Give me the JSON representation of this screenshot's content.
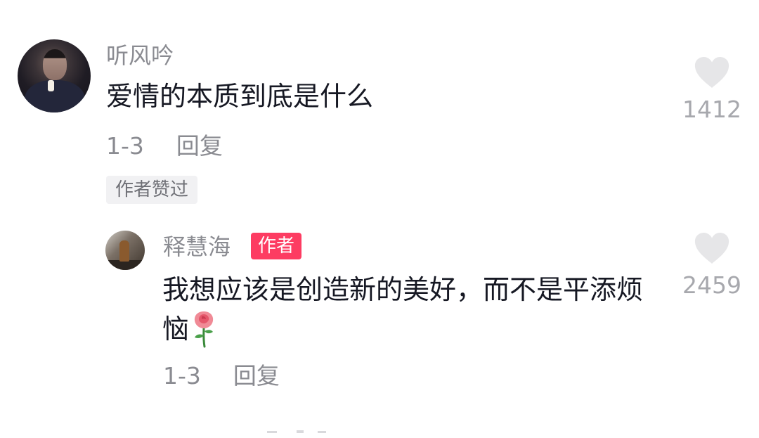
{
  "comment": {
    "username": "听风吟",
    "text": "爱情的本质到底是什么",
    "date": "1-3",
    "reply_label": "回复",
    "liked_by_author_tag": "作者赞过",
    "like_count": "1412",
    "like_icon": "heart-icon"
  },
  "reply": {
    "username": "释慧海",
    "author_badge": "作者",
    "text": "我想应该是创造新的美好，而不是平添烦恼",
    "emoji_icon": "rose-icon",
    "date": "1-3",
    "reply_label": "回复",
    "like_count": "2459",
    "like_icon": "heart-icon"
  },
  "colors": {
    "text_primary": "#161823",
    "text_secondary": "#8a8b91",
    "heart": "#e6e6e8",
    "author_badge_bg": "#fd3c62"
  }
}
